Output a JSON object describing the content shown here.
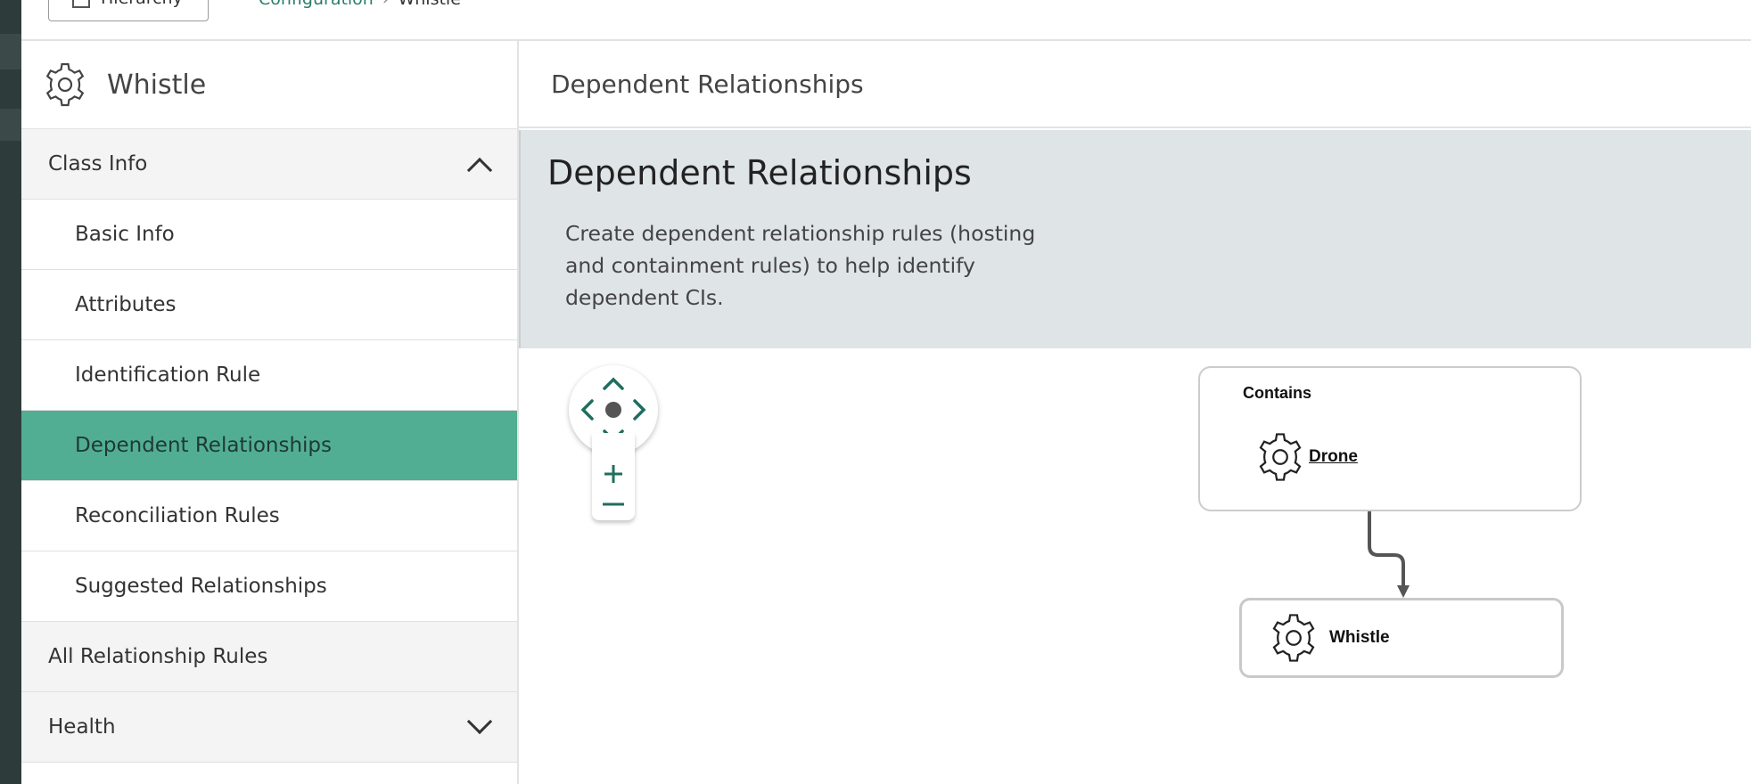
{
  "topbar": {
    "hierarchy_label": "Hierarchy",
    "breadcrumbs": [
      "Configuration",
      "Whistle"
    ]
  },
  "sidebar": {
    "title": "Whistle",
    "sections": {
      "class_info": "Class Info",
      "all_rules": "All Relationship Rules",
      "health": "Health"
    },
    "class_info_items": [
      "Basic Info",
      "Attributes",
      "Identification Rule",
      "Dependent Relationships",
      "Reconciliation Rules",
      "Suggested Relationships"
    ],
    "active_item": "Dependent Relationships"
  },
  "main": {
    "header_title": "Dependent Relationships",
    "banner_title": "Dependent Relationships",
    "banner_description": "Create dependent relationship rules (hosting and containment rules) to help identify dependent CIs."
  },
  "diagram": {
    "relation_label": "Contains",
    "parent_class": "Drone",
    "child_class": "Whistle"
  },
  "colors": {
    "accent": "#52ae93",
    "icon_teal": "#1f6e60",
    "banner_bg": "#dfe4e7",
    "strip": "#2e3b3b"
  }
}
